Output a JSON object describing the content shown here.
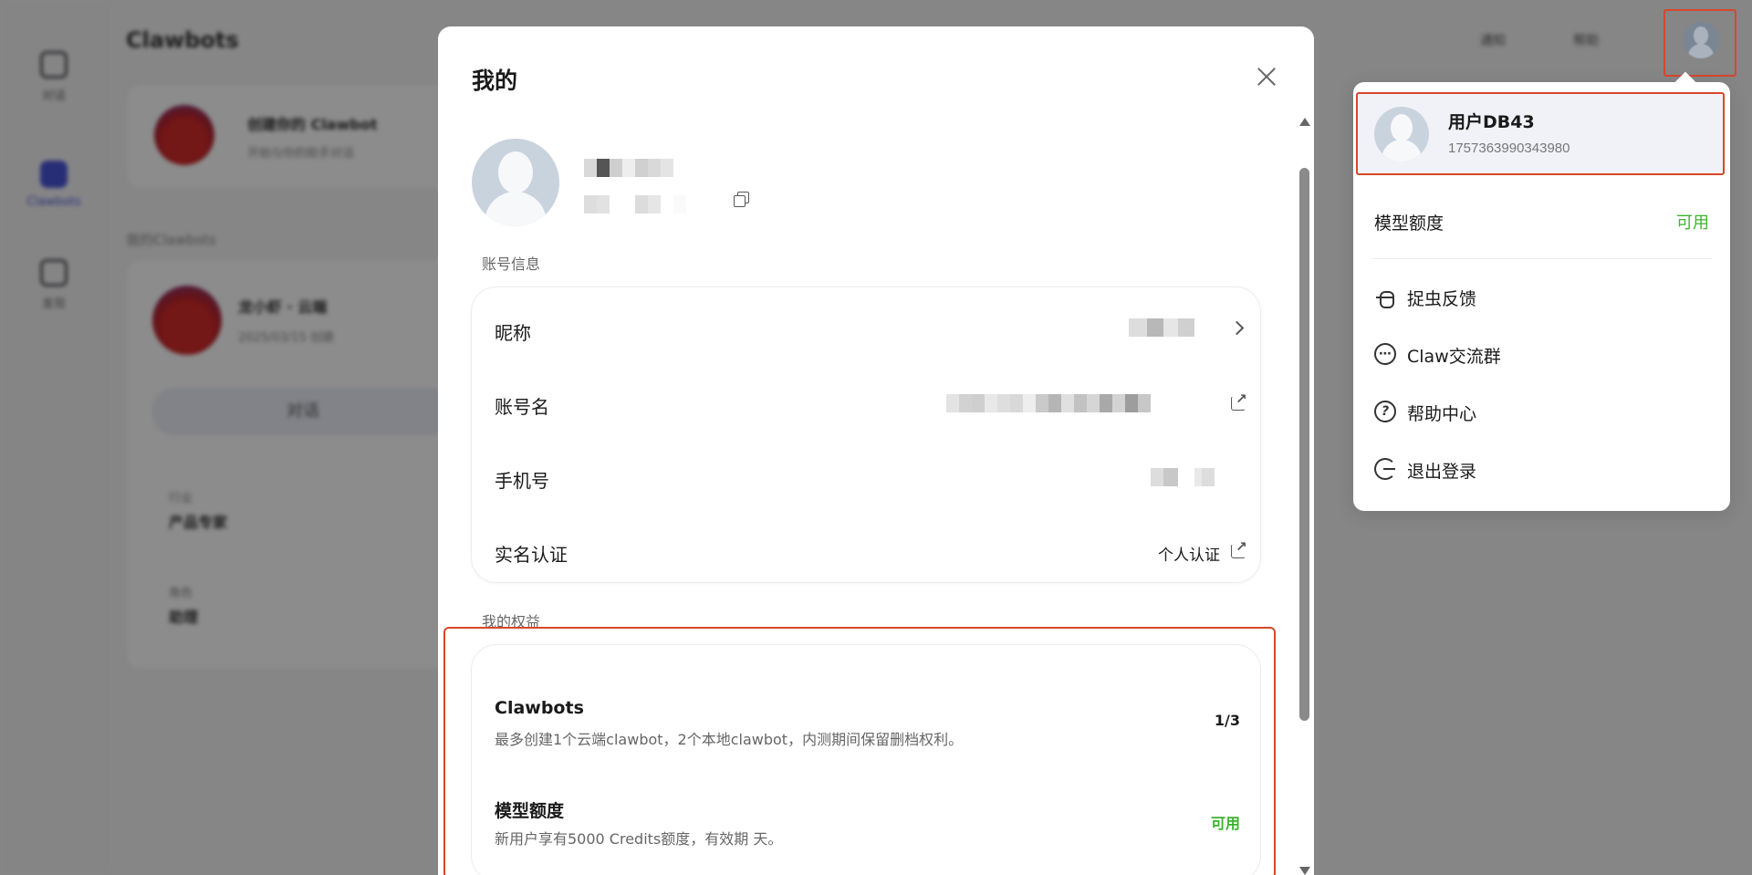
{
  "background": {
    "app_title": "Clawbots",
    "sidebar": [
      {
        "label": "对话"
      },
      {
        "label": "Clawbots"
      },
      {
        "label": "发现"
      }
    ],
    "top_actions": [
      "通知",
      "帮助"
    ],
    "bot_card": {
      "name": "创建你的 Clawbot",
      "desc": "开始与你的助手对话"
    },
    "section": "我的Clawbots",
    "bot2": {
      "name": "龙小虾 · 云端",
      "desc": "2025/03/15 创建",
      "chat_button": "对话"
    },
    "fields": [
      {
        "label": "行业",
        "value": "产品专家"
      },
      {
        "label": "角色",
        "value": "助理"
      }
    ]
  },
  "modal": {
    "title": "我的",
    "account_section_label": "账号信息",
    "rows": [
      {
        "label": "昵称",
        "value": ""
      },
      {
        "label": "账号名",
        "value": ""
      },
      {
        "label": "手机号",
        "value": ""
      },
      {
        "label": "实名认证",
        "value": "个人认证"
      }
    ],
    "rights_section_label": "我的权益",
    "rights": [
      {
        "title": "Clawbots",
        "desc": "最多创建1个云端clawbot，2个本地clawbot，内测期间保留删档权利。",
        "value": "1/3"
      },
      {
        "title": "模型额度",
        "desc": "新用户享有5000 Credits额度，有效期   天。",
        "value": "可用"
      }
    ]
  },
  "dropdown": {
    "user_name": "用户DB43",
    "user_id": "1757363990343980",
    "quota_label": "模型额度",
    "quota_status": "可用",
    "items": [
      {
        "label": "捉虫反馈",
        "icon": "bug-icon"
      },
      {
        "label": "Claw交流群",
        "icon": "chat-bubble-icon"
      },
      {
        "label": "帮助中心",
        "icon": "help-icon"
      },
      {
        "label": "退出登录",
        "icon": "logout-icon"
      }
    ]
  },
  "colors": {
    "accent": "#4a55d8",
    "available_green": "#3bb32d",
    "highlight_red": "#d9462b"
  }
}
